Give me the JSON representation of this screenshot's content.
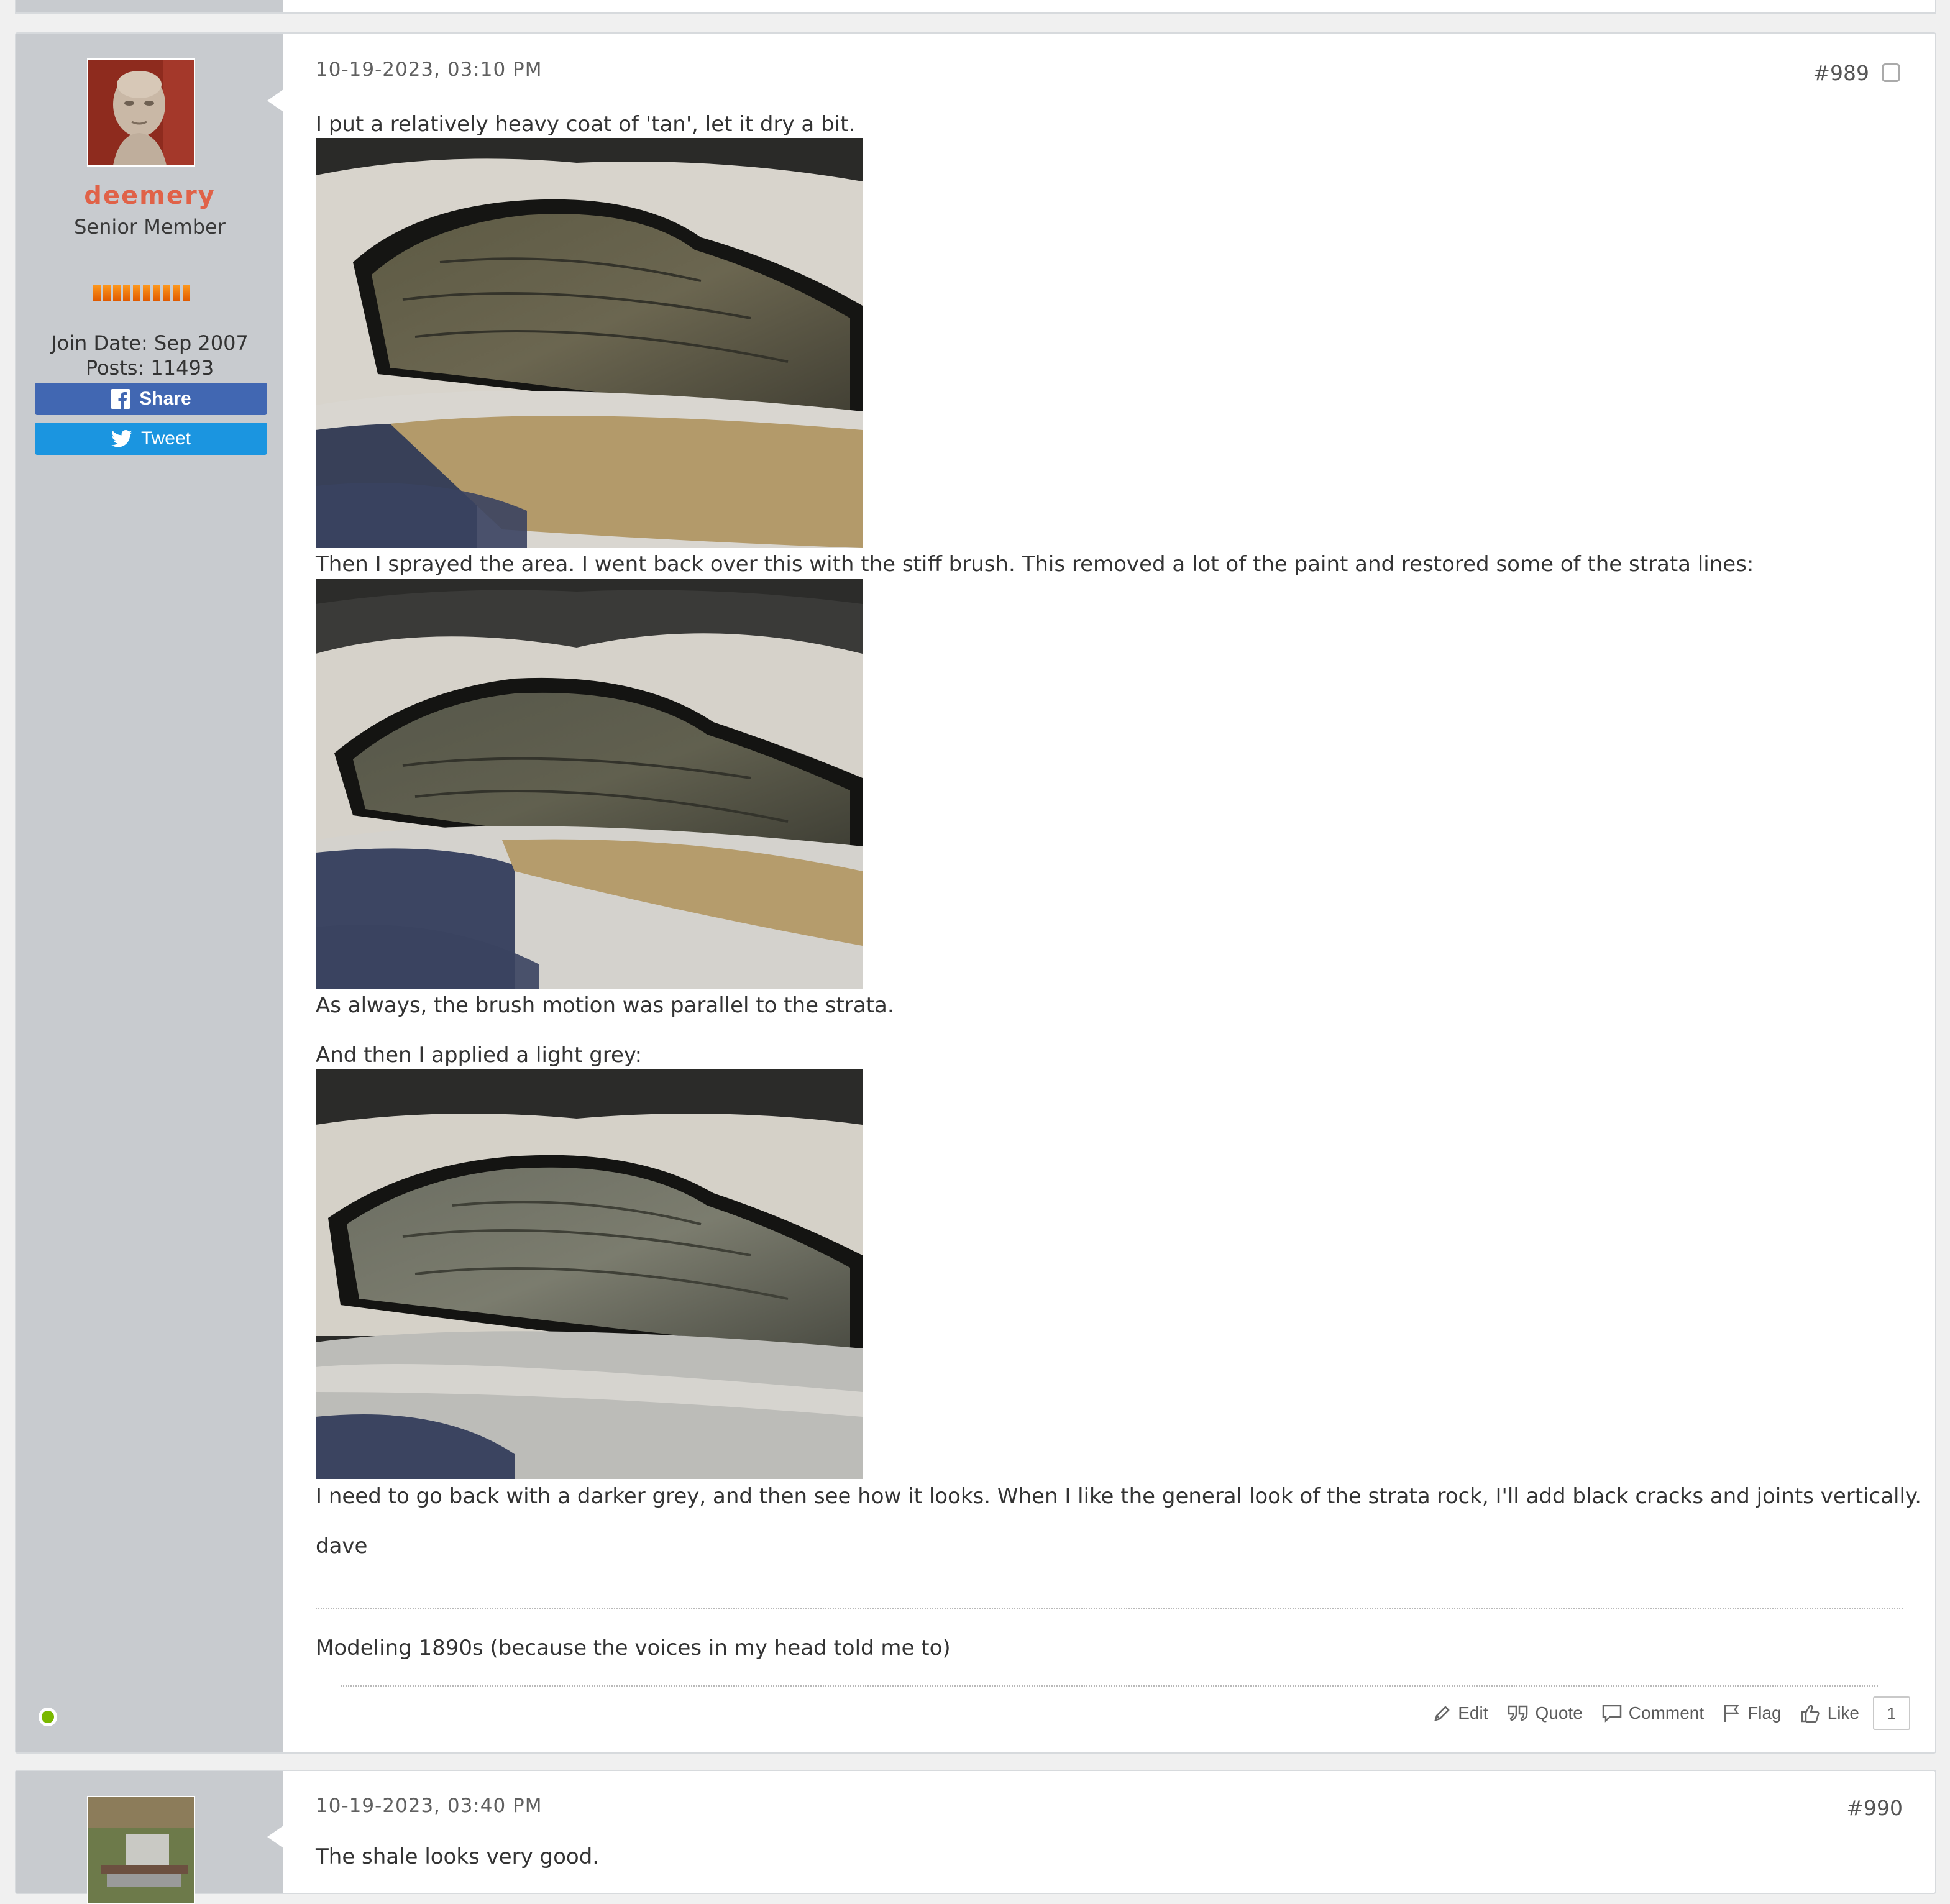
{
  "post989": {
    "author": {
      "username": "deemery",
      "title": "Senior Member",
      "join_date": "Join Date: Sep 2007",
      "posts": "Posts: 11493",
      "reputation_bars": 10,
      "online": true
    },
    "social": {
      "share_label": "Share",
      "tweet_label": "Tweet"
    },
    "date": "10-19-2023, 03:10 PM",
    "number": "#989",
    "body": {
      "p1": "I put a relatively heavy coat of 'tan', let it dry a bit.",
      "p2": "Then I sprayed the area. I went back over this with the stiff brush. This removed a lot of the paint and restored some of the strata lines:",
      "p3": "As always, the brush motion was parallel to the strata.",
      "p4": "And then I applied a light grey:",
      "p5": "I need to go back with a darker grey, and then see how it looks. When I like the general look of the strata rock, I'll add black cracks and joints vertically.",
      "p6": "dave"
    },
    "signature": "Modeling 1890s (because the voices in my head told me to)",
    "actions": {
      "edit": "Edit",
      "quote": "Quote",
      "comment": "Comment",
      "flag": "Flag",
      "like": "Like",
      "like_count": "1"
    }
  },
  "post990": {
    "date": "10-19-2023, 03:40 PM",
    "number": "#990",
    "body": "The shale looks very good."
  },
  "colors": {
    "username": "#e06248",
    "facebook": "#4167b2",
    "twitter": "#1b95e0",
    "online": "#7ab800",
    "sidebar": "#c8cbcf"
  }
}
